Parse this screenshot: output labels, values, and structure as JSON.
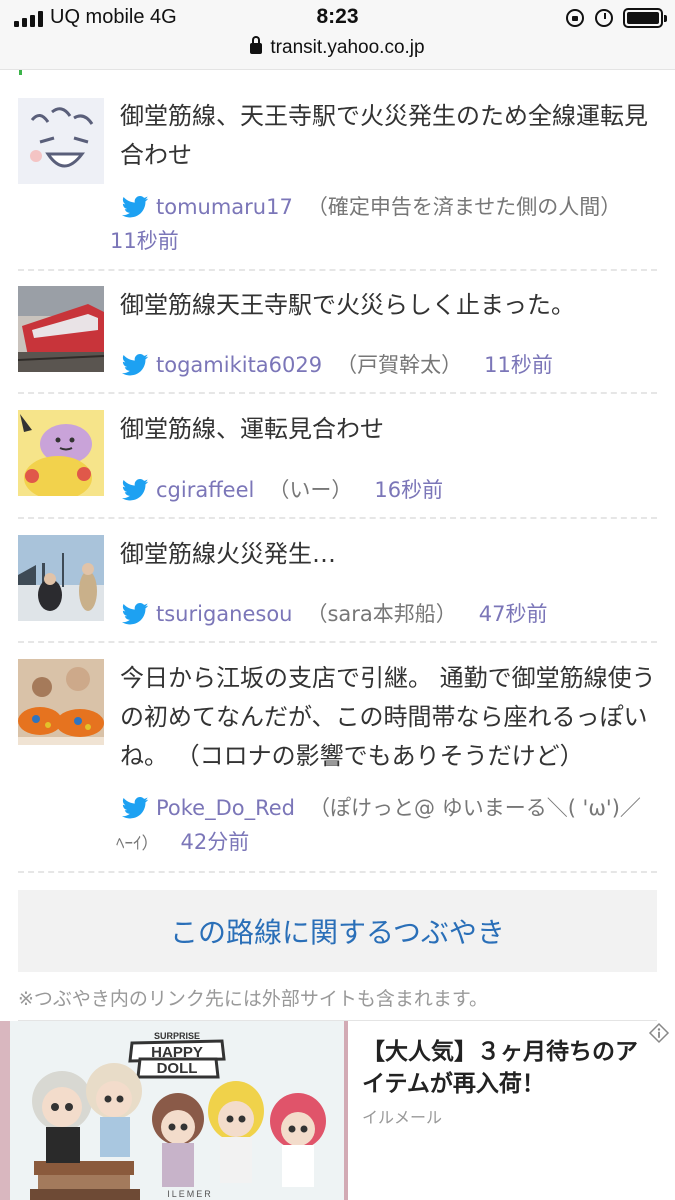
{
  "status_bar": {
    "carrier": "UQ mobile  4G",
    "time": "8:23",
    "url": "transit.yahoo.co.jp"
  },
  "tweets": [
    {
      "text": "御堂筋線、天王寺駅で火災発生のため全線運転見合わせ",
      "username": "tomumaru17",
      "display_name": "（確定申告を済ませた側の人間）",
      "time_ago": "11秒前"
    },
    {
      "text": "御堂筋線天王寺駅で火災らしく止まった。",
      "username": "togamikita6029",
      "display_name": "（戸賀幹太）",
      "time_ago": "11秒前"
    },
    {
      "text": "御堂筋線、運転見合わせ",
      "username": "cgiraffeel",
      "display_name": "（いー）",
      "time_ago": "16秒前"
    },
    {
      "text": "御堂筋線火災発生…",
      "username": "tsuriganesou",
      "display_name": "（sara本邦船）",
      "time_ago": "47秒前"
    },
    {
      "text": "今日から江坂の支店で引継。 通勤で御堂筋線使うの初めてなんだが、この時間帯なら座れるっぽいね。 （コロナの影響でもありそうだけど）",
      "username": "Poke_Do_Red",
      "display_name": "（ぽけっと@ ゆいまーる＼( 'ω')／ﾍｰｲ）",
      "display_name_line1": "（ぽけっと@ ゆいまーる＼( 'ω')／",
      "display_name_line2": "ﾍｰｲ）",
      "time_ago": "42分前"
    }
  ],
  "more_button": {
    "label": "この路線に関するつぶやき"
  },
  "notice": "※つぶやき内のリンク先には外部サイトも含まれます。",
  "ad": {
    "title": "【大人気】３ヶ月待ちのアイテムが再入荷！",
    "title_line1": "【大人気】３ヶ月待ちのア",
    "title_line2": "イテムが再入荷！",
    "source": "イルメール",
    "image_text_top": "SURPRISE",
    "image_text_main1": "HAPPY",
    "image_text_main2": "DOLL",
    "image_text_bottom": "ILEMER"
  },
  "colors": {
    "link": "#7b76b8",
    "button_text": "#2a6fb8",
    "twitter_blue": "#1da1f2"
  }
}
